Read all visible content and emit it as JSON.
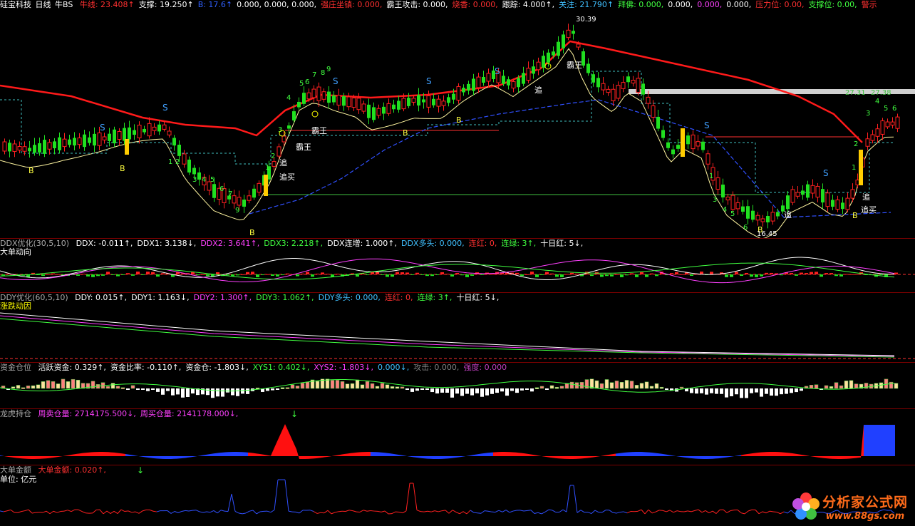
{
  "main": {
    "title": "硅宝科技",
    "period": "日线",
    "indicator": "牛BS",
    "items": [
      {
        "text": "牛线: 23.408↑",
        "color": "#ff3030"
      },
      {
        "text": "支撑: 19.250↑",
        "color": "#ffffff"
      },
      {
        "text": "B: 17.6↑",
        "color": "#3060ff"
      },
      {
        "text": "0.000, 0.000, 0.000,",
        "color": "#ffffff"
      },
      {
        "text": "强庄坐镇: 0.000,",
        "color": "#ff3030"
      },
      {
        "text": "霸王攻击: 0.000,",
        "color": "#ffffff"
      },
      {
        "text": "烧香: 0.000,",
        "color": "#ff3030"
      },
      {
        "text": "跟踪: 4.000↑,",
        "color": "#ffffff"
      },
      {
        "text": "关注: 21.790↑",
        "color": "#40c0ff"
      },
      {
        "text": "拜佛: 0.000,",
        "color": "#40ff40"
      },
      {
        "text": "0.000,",
        "color": "#ffffff"
      },
      {
        "text": "0.000,",
        "color": "#ff40ff"
      },
      {
        "text": "0.000,",
        "color": "#ffffff"
      },
      {
        "text": "压力位: 0.00,",
        "color": "#ff3030"
      },
      {
        "text": "支撑位: 0.00,",
        "color": "#40ff40"
      },
      {
        "text": "警示",
        "color": "#ff3030"
      }
    ],
    "high_label": "30.39",
    "low_label": "16.45",
    "right_labels": [
      "27.31",
      "27.38"
    ],
    "annotations": [
      "霸王",
      "霸王",
      "霸王",
      "追",
      "追买",
      "追",
      "追",
      "追买",
      "追"
    ]
  },
  "ddx": {
    "name": "DDX优化",
    "params": "(30,5,10)",
    "subtitle": "大单动向",
    "items": [
      {
        "text": "DDX: -0.011↑,",
        "color": "#ffffff"
      },
      {
        "text": "DDX1: 3.138↓,",
        "color": "#ffffff"
      },
      {
        "text": "DDX2: 3.641↑,",
        "color": "#ff40ff"
      },
      {
        "text": "DDX3: 2.218↑,",
        "color": "#40ff40"
      },
      {
        "text": "DDX连增: 1.000↑,",
        "color": "#ffffff"
      },
      {
        "text": "DDX多头: 0.000,",
        "color": "#40c0ff"
      },
      {
        "text": "连红: 0,",
        "color": "#ff3030"
      },
      {
        "text": "连绿: 3↑,",
        "color": "#40ff40"
      },
      {
        "text": "十日红: 5↓,",
        "color": "#ffffff"
      }
    ]
  },
  "ddy": {
    "name": "DDY优化",
    "params": "(60,5,10)",
    "subtitle": "涨跌动因",
    "items": [
      {
        "text": "DDY: 0.015↑,",
        "color": "#ffffff"
      },
      {
        "text": "DDY1: 1.163↓,",
        "color": "#ffffff"
      },
      {
        "text": "DDY2: 1.300↑,",
        "color": "#ff40ff"
      },
      {
        "text": "DDY3: 1.062↑,",
        "color": "#40ff40"
      },
      {
        "text": "DDY多头: 0.000,",
        "color": "#40c0ff"
      },
      {
        "text": "连红: 0,",
        "color": "#ff3030"
      },
      {
        "text": "连绿: 3↑,",
        "color": "#40ff40"
      },
      {
        "text": "十日红: 5↓,",
        "color": "#ffffff"
      }
    ]
  },
  "fund": {
    "name": "资金仓位",
    "items": [
      {
        "text": "活跃资金: 0.329↑,",
        "color": "#ffffff"
      },
      {
        "text": "资金比率: -0.110↑,",
        "color": "#ffffff"
      },
      {
        "text": "资金仓: -1.803↓,",
        "color": "#ffffff"
      },
      {
        "text": "XYS1: 0.402↓,",
        "color": "#40ff40"
      },
      {
        "text": "XYS2: -1.803↓,",
        "color": "#ff40ff"
      },
      {
        "text": "0.000↓,",
        "color": "#40c0ff"
      },
      {
        "text": "攻击: 0.000,",
        "color": "#808080"
      },
      {
        "text": "强度: 0.000",
        "color": "#c040c0"
      }
    ]
  },
  "dragon": {
    "name": "龙虎持仓",
    "items": [
      {
        "text": "周卖仓量: 2714175.500↓,",
        "color": "#ff40ff"
      },
      {
        "text": "周买仓量: 2141178.000↓,",
        "color": "#ff40ff"
      }
    ]
  },
  "bigorder": {
    "name": "大单金额",
    "items": [
      {
        "text": "大单金额: 0.020↑,",
        "color": "#ff3030"
      }
    ],
    "unit": "单位: 亿元"
  },
  "watermark": {
    "title": "分析家公式网",
    "url": "www.88gs.com"
  },
  "colors": {
    "up": "#ff2020",
    "down": "#20e020",
    "grid": "#7a0000",
    "bull_line": "#ff1a1a",
    "support_line": "#fff5a0",
    "b_line": "#3050ff"
  }
}
